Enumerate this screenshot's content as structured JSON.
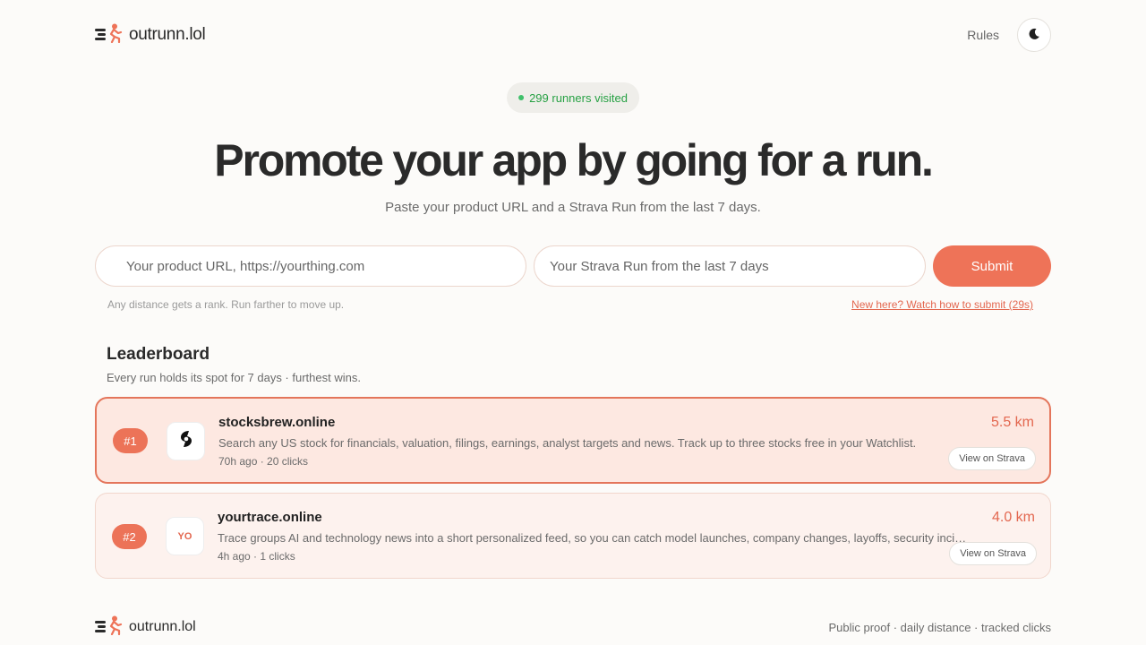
{
  "header": {
    "brand_name": "outrunn.lol",
    "rules_label": "Rules",
    "theme_icon": "moon-icon"
  },
  "badge": {
    "text": "299 runners visited",
    "dot_color": "#3fc06a"
  },
  "hero": {
    "title": "Promote your app by going for a run.",
    "subtitle": "Paste your product URL and a Strava Run from the last 7 days."
  },
  "form": {
    "url_placeholder": "Your product URL, https://yourthing.com",
    "url_value": "",
    "strava_placeholder": "Your Strava Run from the last 7 days",
    "strava_value": "",
    "submit_label": "Submit",
    "hint_left": "Any distance gets a rank. Run farther to move up.",
    "hint_link": "New here? Watch how to submit (29s)"
  },
  "leaderboard": {
    "title": "Leaderboard",
    "subtitle": "Every run holds its spot for 7 days · furthest wins.",
    "entries": [
      {
        "rank": "#1",
        "logo": "swirl-logo-icon",
        "name": "stocksbrew.online",
        "description": "Search any US stock for financials, valuation, filings, earnings, analyst targets and news. Track up to three stocks free in your Watchlist.",
        "meta": "70h ago · 20 clicks",
        "distance": "5.5 km",
        "strava_label": "View on Strava"
      },
      {
        "rank": "#2",
        "logo_text": "YO",
        "name": "yourtrace.online",
        "description": "Trace groups AI and technology news into a short personalized feed, so you can catch model launches, company changes, layoffs, security incidents and more.",
        "meta": "4h ago · 1 clicks",
        "distance": "4.0 km",
        "strava_label": "View on Strava"
      }
    ]
  },
  "footer": {
    "brand_name": "outrunn.lol",
    "tagline": "Public proof · daily distance · tracked clicks"
  },
  "colors": {
    "accent": "#ee7358",
    "text": "#2a2a2a",
    "background": "#fcfbf9"
  }
}
